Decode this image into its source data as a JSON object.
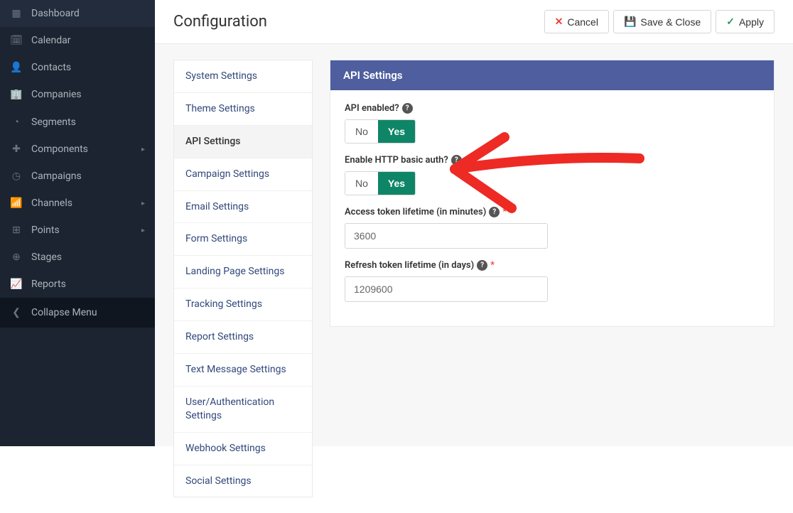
{
  "page": {
    "title": "Configuration"
  },
  "actions": {
    "cancel": "Cancel",
    "save_close": "Save & Close",
    "apply": "Apply"
  },
  "sidebar": {
    "items": [
      {
        "icon": "▦",
        "label": "Dashboard",
        "expandable": false
      },
      {
        "icon": "📅",
        "label": "Calendar",
        "expandable": false
      },
      {
        "icon": "👤",
        "label": "Contacts",
        "expandable": false
      },
      {
        "icon": "🏢",
        "label": "Companies",
        "expandable": false
      },
      {
        "icon": "◔",
        "label": "Segments",
        "expandable": false
      },
      {
        "icon": "✚",
        "label": "Components",
        "expandable": true
      },
      {
        "icon": "◷",
        "label": "Campaigns",
        "expandable": false
      },
      {
        "icon": "📶",
        "label": "Channels",
        "expandable": true
      },
      {
        "icon": "⊞",
        "label": "Points",
        "expandable": true
      },
      {
        "icon": "⊕",
        "label": "Stages",
        "expandable": false
      },
      {
        "icon": "📈",
        "label": "Reports",
        "expandable": false
      }
    ],
    "collapse_label": "Collapse Menu"
  },
  "settings_nav": {
    "active_index": 2,
    "items": [
      "System Settings",
      "Theme Settings",
      "API Settings",
      "Campaign Settings",
      "Email Settings",
      "Form Settings",
      "Landing Page Settings",
      "Tracking Settings",
      "Report Settings",
      "Text Message Settings",
      "User/Authentication Settings",
      "Webhook Settings",
      "Social Settings"
    ]
  },
  "panel": {
    "title": "API Settings",
    "toggles": {
      "no": "No",
      "yes": "Yes"
    },
    "fields": {
      "api_enabled": {
        "label": "API enabled?",
        "value": "Yes"
      },
      "http_basic": {
        "label": "Enable HTTP basic auth?",
        "value": "Yes"
      },
      "access_token": {
        "label": "Access token lifetime (in minutes)",
        "value": "3600",
        "required": true
      },
      "refresh_token": {
        "label": "Refresh token lifetime (in days)",
        "value": "1209600",
        "required": true
      }
    }
  }
}
